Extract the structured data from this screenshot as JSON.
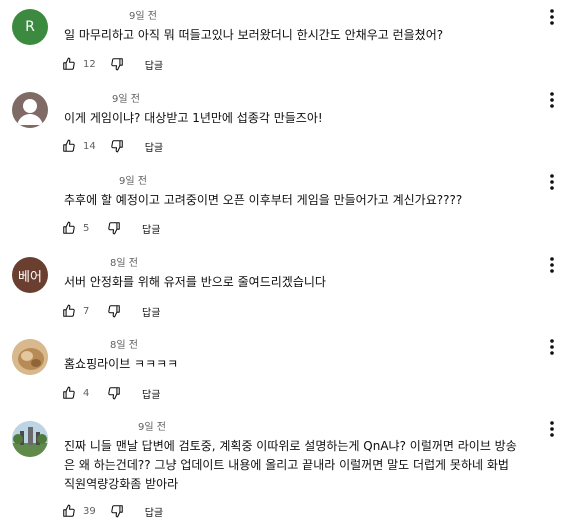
{
  "comments": [
    {
      "avatar_letter": "R",
      "avatar_color": "#3c8a3f",
      "time": "9일 전",
      "text": "일 마무리하고 아직 뭐 떠들고있나 보러왔더니 한시간도 안채우고 런을쳤어?",
      "likes": "12",
      "reply": "답글"
    },
    {
      "avatar_letter": "",
      "avatar_color": "#8a6a63",
      "time": "9일 전",
      "text": "이게 게임이냐? 대상받고 1년만에 섭종각 만들즈아!",
      "likes": "14",
      "reply": "답글"
    },
    {
      "avatar_letter": "",
      "avatar_color": "#ffffff",
      "time": "9일 전",
      "text": "추후에 할 예정이고 고려중이면 오픈 이후부터 게임을 만들어가고 계신가요????",
      "likes": "5",
      "reply": "답글"
    },
    {
      "avatar_letter": "베어",
      "avatar_color": "#6b3f2f",
      "time": "8일 전",
      "text": "서버 안정화를 위해 유저를 반으로 줄여드리겠습니다",
      "likes": "7",
      "reply": "답글"
    },
    {
      "avatar_letter": "",
      "avatar_color": "#c9a77a",
      "time": "8일 전",
      "text": "홈쇼핑라이브 ㅋㅋㅋㅋ",
      "likes": "4",
      "reply": "답글"
    },
    {
      "avatar_letter": "",
      "avatar_color": "#9fbfd6",
      "time": "9일 전",
      "text": "진짜 니들 맨날 답변에 검토중, 계획중 이따위로 설명하는게 QnA냐? 이럴꺼면 라이브 방송은 왜 하는건데?? 그냥 업데이트 내용에 올리고 끝내라 이럴꺼면 말도 더럽게 못하네 화법 직원역량강화좀 받아라",
      "likes": "39",
      "reply": "답글"
    }
  ],
  "icons": {
    "like": "thumbs-up-icon",
    "dislike": "thumbs-down-icon",
    "menu": "more-vertical-icon"
  }
}
